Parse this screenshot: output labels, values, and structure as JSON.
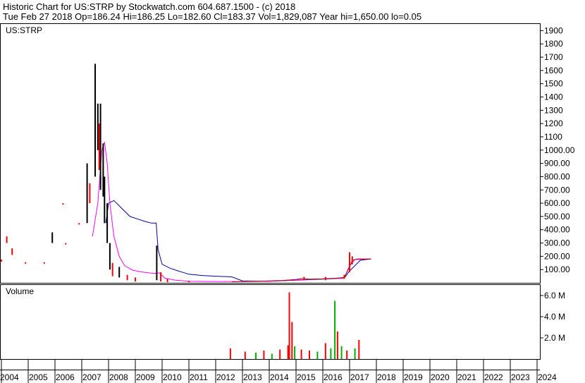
{
  "header": {
    "line1": "Historic Chart for US:STRP by Stockwatch.com 604.687.1500 - (c) 2018",
    "line2": "Tue Feb 27 2018  Op=186.24  Hi=186.25  Lo=182.60  Cl=183.37  Vol=1,829,087  Year hi=1,650.00  lo=0.05"
  },
  "chart_data": [
    {
      "type": "line",
      "title": "US:STRP",
      "x_axis_labels": [
        "2004",
        "2005",
        "2006",
        "2007",
        "2008",
        "2009",
        "2010",
        "2011",
        "2012",
        "2013",
        "2014",
        "2015",
        "2016",
        "2017",
        "2018",
        "2019",
        "2020",
        "2021",
        "2022",
        "2023",
        "2024"
      ],
      "y_tick_labels": [
        "100.00",
        "200.00",
        "300.00",
        "400.00",
        "500.00",
        "600.00",
        "700.00",
        "800.00",
        "900.00",
        "1000.00",
        "1100",
        "1200",
        "1300",
        "1400",
        "1500",
        "1600",
        "1700",
        "1800",
        "1900"
      ],
      "ylim": [
        0,
        1950
      ],
      "colors": {
        "price": "#000000",
        "down": "#ff0000",
        "ma_short": "#ff00ff",
        "ma_long": "#0000aa"
      },
      "price_bars": [
        {
          "x": 2004.0,
          "lo": 160,
          "hi": 175,
          "c": "red"
        },
        {
          "x": 2004.2,
          "lo": 300,
          "hi": 350,
          "c": "red"
        },
        {
          "x": 2004.4,
          "lo": 210,
          "hi": 260,
          "c": "red"
        },
        {
          "x": 2004.9,
          "lo": 145,
          "hi": 155,
          "c": "red"
        },
        {
          "x": 2005.6,
          "lo": 145,
          "hi": 155,
          "c": "red"
        },
        {
          "x": 2005.9,
          "lo": 300,
          "hi": 380,
          "c": "black"
        },
        {
          "x": 2006.4,
          "lo": 290,
          "hi": 300,
          "c": "red"
        },
        {
          "x": 2006.3,
          "lo": 590,
          "hi": 600,
          "c": "red"
        },
        {
          "x": 2006.9,
          "lo": 440,
          "hi": 450,
          "c": "red"
        },
        {
          "x": 2007.2,
          "lo": 450,
          "hi": 900,
          "c": "black"
        },
        {
          "x": 2007.3,
          "lo": 600,
          "hi": 750,
          "c": "red"
        },
        {
          "x": 2007.5,
          "lo": 800,
          "hi": 1650,
          "c": "black"
        },
        {
          "x": 2007.6,
          "lo": 1000,
          "hi": 1350,
          "c": "black"
        },
        {
          "x": 2007.65,
          "lo": 850,
          "hi": 1200,
          "c": "red"
        },
        {
          "x": 2007.7,
          "lo": 700,
          "hi": 1350,
          "c": "black"
        },
        {
          "x": 2007.8,
          "lo": 650,
          "hi": 1050,
          "c": "black"
        },
        {
          "x": 2007.85,
          "lo": 450,
          "hi": 800,
          "c": "black"
        },
        {
          "x": 2007.95,
          "lo": 300,
          "hi": 600,
          "c": "black"
        },
        {
          "x": 2008.05,
          "lo": 100,
          "hi": 300,
          "c": "black"
        },
        {
          "x": 2008.15,
          "lo": 50,
          "hi": 150,
          "c": "red"
        },
        {
          "x": 2008.4,
          "lo": 40,
          "hi": 120,
          "c": "black"
        },
        {
          "x": 2008.7,
          "lo": 20,
          "hi": 60,
          "c": "red"
        },
        {
          "x": 2009.0,
          "lo": 10,
          "hi": 40,
          "c": "red"
        },
        {
          "x": 2009.8,
          "lo": 20,
          "hi": 280,
          "c": "black"
        },
        {
          "x": 2009.95,
          "lo": 10,
          "hi": 80,
          "c": "red"
        },
        {
          "x": 2010.2,
          "lo": 5,
          "hi": 30,
          "c": "red"
        },
        {
          "x": 2011.0,
          "lo": 5,
          "hi": 15,
          "c": "red"
        },
        {
          "x": 2015.3,
          "lo": 20,
          "hi": 45,
          "c": "red"
        },
        {
          "x": 2016.1,
          "lo": 20,
          "hi": 45,
          "c": "red"
        },
        {
          "x": 2016.8,
          "lo": 30,
          "hi": 60,
          "c": "red"
        },
        {
          "x": 2017.0,
          "lo": 80,
          "hi": 230,
          "c": "red"
        },
        {
          "x": 2017.1,
          "lo": 140,
          "hi": 200,
          "c": "red"
        }
      ],
      "price_line": [
        [
          2012.6,
          8
        ],
        [
          2013,
          10
        ],
        [
          2013.5,
          12
        ],
        [
          2014,
          15
        ],
        [
          2014.5,
          18
        ],
        [
          2015,
          25
        ],
        [
          2015.2,
          32
        ],
        [
          2015.5,
          28
        ],
        [
          2016,
          30
        ],
        [
          2016.4,
          34
        ],
        [
          2016.8,
          40
        ],
        [
          2017.0,
          120
        ],
        [
          2017.1,
          170
        ],
        [
          2017.3,
          180
        ],
        [
          2017.8,
          180
        ]
      ],
      "ma_short": [
        [
          2007.4,
          350
        ],
        [
          2007.6,
          600
        ],
        [
          2007.75,
          1000
        ],
        [
          2007.85,
          1060
        ],
        [
          2007.95,
          900
        ],
        [
          2008.05,
          600
        ],
        [
          2008.2,
          350
        ],
        [
          2008.4,
          200
        ],
        [
          2008.6,
          130
        ],
        [
          2008.9,
          95
        ],
        [
          2009.3,
          80
        ],
        [
          2009.7,
          70
        ],
        [
          2009.9,
          75
        ],
        [
          2010.1,
          35
        ],
        [
          2010.5,
          20
        ],
        [
          2011.0,
          12
        ],
        [
          2012,
          10
        ],
        [
          2013,
          10
        ],
        [
          2014,
          12
        ],
        [
          2015,
          22
        ],
        [
          2016,
          30
        ],
        [
          2016.8,
          35
        ],
        [
          2017.0,
          130
        ],
        [
          2017.2,
          175
        ],
        [
          2017.8,
          180
        ]
      ],
      "ma_long": [
        [
          2007.9,
          450
        ],
        [
          2008.0,
          600
        ],
        [
          2008.2,
          620
        ],
        [
          2008.5,
          560
        ],
        [
          2008.8,
          500
        ],
        [
          2009.1,
          480
        ],
        [
          2009.4,
          460
        ],
        [
          2009.6,
          450
        ],
        [
          2009.78,
          450
        ],
        [
          2009.85,
          250
        ],
        [
          2010.0,
          140
        ],
        [
          2010.3,
          110
        ],
        [
          2010.6,
          90
        ],
        [
          2011.0,
          65
        ],
        [
          2011.5,
          55
        ],
        [
          2012.0,
          50
        ],
        [
          2012.6,
          45
        ],
        [
          2013.0,
          15
        ],
        [
          2014.0,
          12
        ],
        [
          2015.0,
          20
        ],
        [
          2016.0,
          28
        ],
        [
          2016.8,
          35
        ],
        [
          2017.0,
          90
        ],
        [
          2017.4,
          170
        ],
        [
          2017.8,
          180
        ]
      ]
    },
    {
      "type": "bar",
      "title": "Volume",
      "y_tick_labels": [
        "2.0 M",
        "4.0 M",
        "6.0 M"
      ],
      "ylim": [
        0,
        7000000
      ],
      "volume_bars": [
        {
          "x": 2012.55,
          "v": 1000000,
          "c": "red"
        },
        {
          "x": 2013.1,
          "v": 700000,
          "c": "red"
        },
        {
          "x": 2013.5,
          "v": 600000,
          "c": "green"
        },
        {
          "x": 2013.8,
          "v": 800000,
          "c": "red"
        },
        {
          "x": 2014.1,
          "v": 500000,
          "c": "green"
        },
        {
          "x": 2014.4,
          "v": 900000,
          "c": "red"
        },
        {
          "x": 2014.7,
          "v": 1300000,
          "c": "red"
        },
        {
          "x": 2014.75,
          "v": 6300000,
          "c": "red"
        },
        {
          "x": 2014.85,
          "v": 3500000,
          "c": "red"
        },
        {
          "x": 2014.95,
          "v": 1200000,
          "c": "green"
        },
        {
          "x": 2015.2,
          "v": 900000,
          "c": "red"
        },
        {
          "x": 2015.5,
          "v": 800000,
          "c": "red"
        },
        {
          "x": 2015.8,
          "v": 700000,
          "c": "green"
        },
        {
          "x": 2016.1,
          "v": 1500000,
          "c": "red"
        },
        {
          "x": 2016.3,
          "v": 1000000,
          "c": "green"
        },
        {
          "x": 2016.45,
          "v": 5500000,
          "c": "green"
        },
        {
          "x": 2016.55,
          "v": 2600000,
          "c": "red"
        },
        {
          "x": 2016.7,
          "v": 1200000,
          "c": "green"
        },
        {
          "x": 2016.9,
          "v": 800000,
          "c": "red"
        },
        {
          "x": 2017.2,
          "v": 1000000,
          "c": "green"
        },
        {
          "x": 2017.35,
          "v": 1800000,
          "c": "red"
        }
      ]
    }
  ]
}
